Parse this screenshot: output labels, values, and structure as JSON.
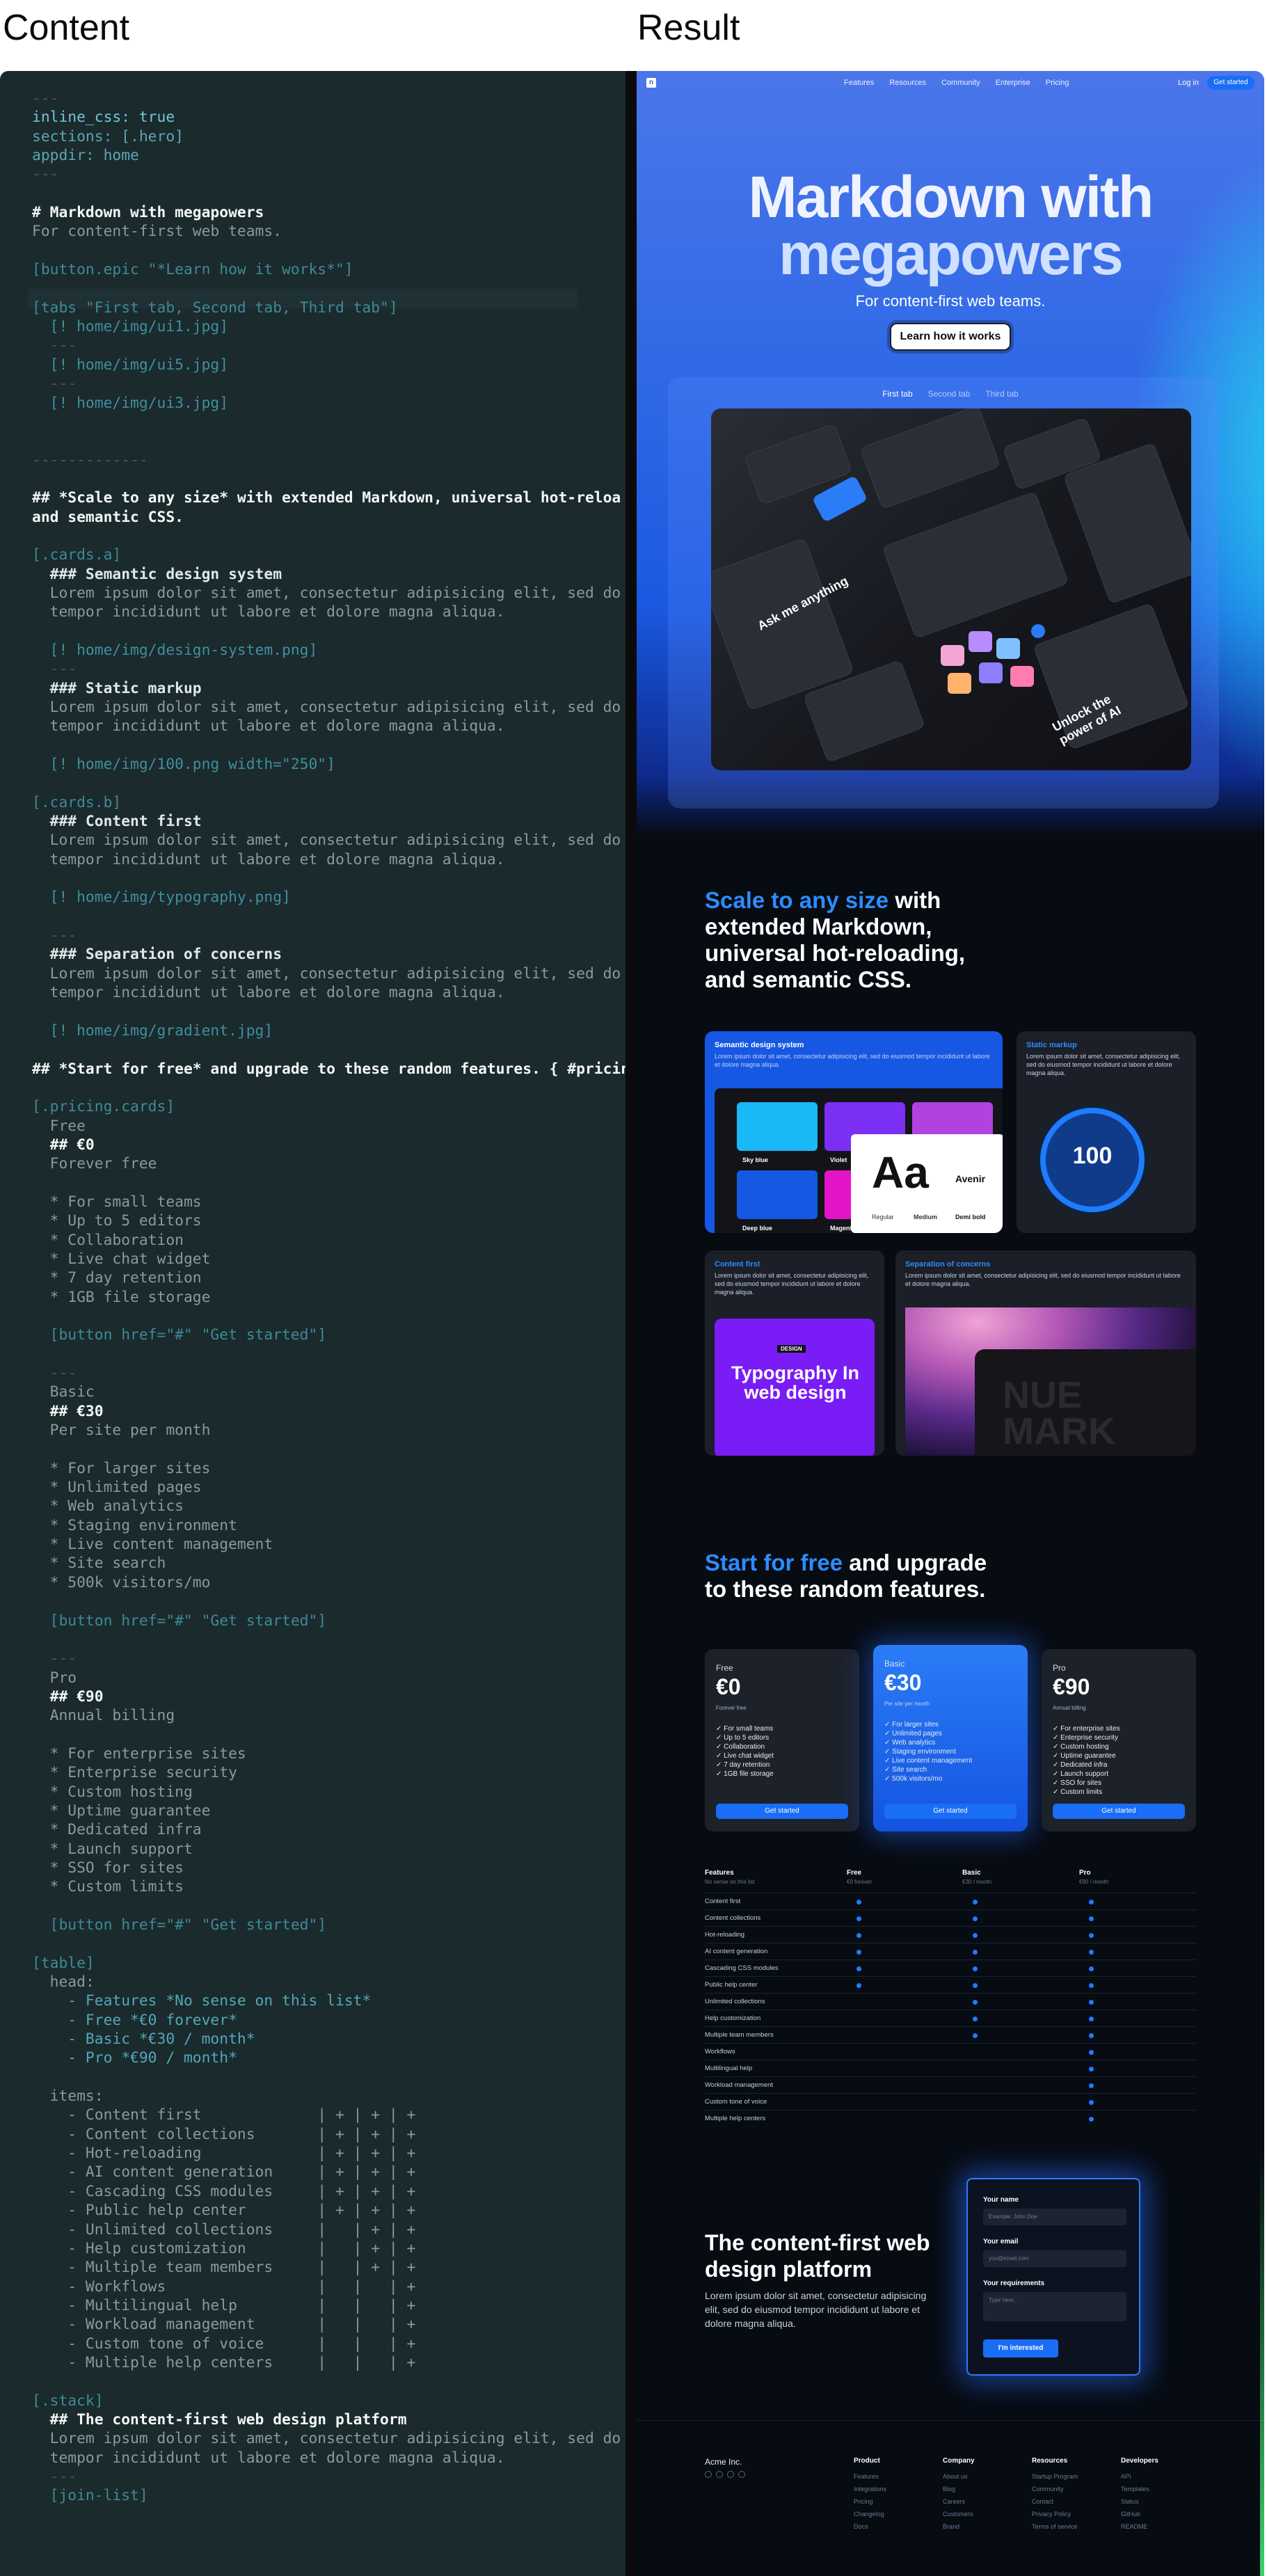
{
  "headers": {
    "left": "Content",
    "right": "Result"
  },
  "editor": {
    "lines": [
      {
        "t": "---",
        "c": "t-dim"
      },
      {
        "t": "inline_css: true",
        "c": "t-val"
      },
      {
        "t": "sections: [.hero]",
        "c": "t-key"
      },
      {
        "t": "appdir: home",
        "c": "t-key"
      },
      {
        "t": "---",
        "c": "t-dim"
      },
      {
        "t": "",
        "c": ""
      },
      {
        "t": "# Markdown with megapowers",
        "c": "t-head"
      },
      {
        "t": "For content-first web teams.",
        "c": "t-txt"
      },
      {
        "t": "",
        "c": ""
      },
      {
        "t": "[button.epic \"*Learn how it works*\"]",
        "c": "t-sec"
      },
      {
        "t": "",
        "c": ""
      },
      {
        "t": "[tabs \"First tab, Second tab, Third tab\"]",
        "c": "t-sec"
      },
      {
        "t": "  [! home/img/ui1.jpg]",
        "c": "t-link"
      },
      {
        "t": "  ---",
        "c": "t-dim"
      },
      {
        "t": "  [! home/img/ui5.jpg]",
        "c": "t-link"
      },
      {
        "t": "  ---",
        "c": "t-dim"
      },
      {
        "t": "  [! home/img/ui3.jpg]",
        "c": "t-link"
      },
      {
        "t": "",
        "c": ""
      },
      {
        "t": "",
        "c": ""
      },
      {
        "t": "-------------",
        "c": "t-dim"
      },
      {
        "t": "",
        "c": ""
      },
      {
        "t": "## *Scale to any size* with extended Markdown, universal hot-reloa",
        "c": "t-head"
      },
      {
        "t": "and semantic CSS.",
        "c": "t-head"
      },
      {
        "t": "",
        "c": ""
      },
      {
        "t": "[.cards.a]",
        "c": "t-sec"
      },
      {
        "t": "  ### Semantic design system",
        "c": "t-bright"
      },
      {
        "t": "  Lorem ipsum dolor sit amet, consectetur adipisicing elit, sed do",
        "c": "t-txt"
      },
      {
        "t": "  tempor incididunt ut labore et dolore magna aliqua.",
        "c": "t-txt"
      },
      {
        "t": "",
        "c": ""
      },
      {
        "t": "  [! home/img/design-system.png]",
        "c": "t-link"
      },
      {
        "t": "  ---",
        "c": "t-dim"
      },
      {
        "t": "  ### Static markup",
        "c": "t-bright"
      },
      {
        "t": "  Lorem ipsum dolor sit amet, consectetur adipisicing elit, sed do",
        "c": "t-txt"
      },
      {
        "t": "  tempor incididunt ut labore et dolore magna aliqua.",
        "c": "t-txt"
      },
      {
        "t": "",
        "c": ""
      },
      {
        "t": "  [! home/img/100.png width=\"250\"]",
        "c": "t-link"
      },
      {
        "t": "",
        "c": ""
      },
      {
        "t": "[.cards.b]",
        "c": "t-sec"
      },
      {
        "t": "  ### Content first",
        "c": "t-bright"
      },
      {
        "t": "  Lorem ipsum dolor sit amet, consectetur adipisicing elit, sed do",
        "c": "t-txt"
      },
      {
        "t": "  tempor incididunt ut labore et dolore magna aliqua.",
        "c": "t-txt"
      },
      {
        "t": "",
        "c": ""
      },
      {
        "t": "  [! home/img/typography.png]",
        "c": "t-link"
      },
      {
        "t": "",
        "c": ""
      },
      {
        "t": "  ---",
        "c": "t-dim"
      },
      {
        "t": "  ### Separation of concerns",
        "c": "t-bright"
      },
      {
        "t": "  Lorem ipsum dolor sit amet, consectetur adipisicing elit, sed do",
        "c": "t-txt"
      },
      {
        "t": "  tempor incididunt ut labore et dolore magna aliqua.",
        "c": "t-txt"
      },
      {
        "t": "",
        "c": ""
      },
      {
        "t": "  [! home/img/gradient.jpg]",
        "c": "t-link"
      },
      {
        "t": "",
        "c": ""
      },
      {
        "t": "## *Start for free* and upgrade to these random features. { #pricing }",
        "c": "t-head"
      },
      {
        "t": "",
        "c": ""
      },
      {
        "t": "[.pricing.cards]",
        "c": "t-sec"
      },
      {
        "t": "  Free",
        "c": "t-txt"
      },
      {
        "t": "  ## €0",
        "c": "t-head"
      },
      {
        "t": "  Forever free",
        "c": "t-txt"
      },
      {
        "t": "",
        "c": ""
      },
      {
        "t": "  * For small teams",
        "c": "t-txt"
      },
      {
        "t": "  * Up to 5 editors",
        "c": "t-txt"
      },
      {
        "t": "  * Collaboration",
        "c": "t-txt"
      },
      {
        "t": "  * Live chat widget",
        "c": "t-txt"
      },
      {
        "t": "  * 7 day retention",
        "c": "t-txt"
      },
      {
        "t": "  * 1GB file storage",
        "c": "t-txt"
      },
      {
        "t": "",
        "c": ""
      },
      {
        "t": "  [button href=\"#\" \"Get started\"]",
        "c": "t-sec"
      },
      {
        "t": "",
        "c": ""
      },
      {
        "t": "  ---",
        "c": "t-dim"
      },
      {
        "t": "  Basic",
        "c": "t-txt"
      },
      {
        "t": "  ## €30",
        "c": "t-head"
      },
      {
        "t": "  Per site per month",
        "c": "t-txt"
      },
      {
        "t": "",
        "c": ""
      },
      {
        "t": "  * For larger sites",
        "c": "t-txt"
      },
      {
        "t": "  * Unlimited pages",
        "c": "t-txt"
      },
      {
        "t": "  * Web analytics",
        "c": "t-txt"
      },
      {
        "t": "  * Staging environment",
        "c": "t-txt"
      },
      {
        "t": "  * Live content management",
        "c": "t-txt"
      },
      {
        "t": "  * Site search",
        "c": "t-txt"
      },
      {
        "t": "  * 500k visitors/mo",
        "c": "t-txt"
      },
      {
        "t": "",
        "c": ""
      },
      {
        "t": "  [button href=\"#\" \"Get started\"]",
        "c": "t-sec"
      },
      {
        "t": "",
        "c": ""
      },
      {
        "t": "  ---",
        "c": "t-dim"
      },
      {
        "t": "  Pro",
        "c": "t-txt"
      },
      {
        "t": "  ## €90",
        "c": "t-head"
      },
      {
        "t": "  Annual billing",
        "c": "t-txt"
      },
      {
        "t": "",
        "c": ""
      },
      {
        "t": "  * For enterprise sites",
        "c": "t-txt"
      },
      {
        "t": "  * Enterprise security",
        "c": "t-txt"
      },
      {
        "t": "  * Custom hosting",
        "c": "t-txt"
      },
      {
        "t": "  * Uptime guarantee",
        "c": "t-txt"
      },
      {
        "t": "  * Dedicated infra",
        "c": "t-txt"
      },
      {
        "t": "  * Launch support",
        "c": "t-txt"
      },
      {
        "t": "  * SSO for sites",
        "c": "t-txt"
      },
      {
        "t": "  * Custom limits",
        "c": "t-txt"
      },
      {
        "t": "",
        "c": ""
      },
      {
        "t": "  [button href=\"#\" \"Get started\"]",
        "c": "t-sec"
      },
      {
        "t": "",
        "c": ""
      },
      {
        "t": "[table]",
        "c": "t-sec"
      },
      {
        "t": "  head:",
        "c": "t-txt"
      },
      {
        "t": "    - Features *No sense on this list*",
        "c": "t-em"
      },
      {
        "t": "    - Free *€0 forever*",
        "c": "t-em"
      },
      {
        "t": "    - Basic *€30 / month*",
        "c": "t-em"
      },
      {
        "t": "    - Pro *€90 / month*",
        "c": "t-em"
      },
      {
        "t": "",
        "c": ""
      },
      {
        "t": "  items:",
        "c": "t-txt"
      },
      {
        "t": "    - Content first             | + | + | +",
        "c": "t-txt"
      },
      {
        "t": "    - Content collections       | + | + | +",
        "c": "t-txt"
      },
      {
        "t": "    - Hot-reloading             | + | + | +",
        "c": "t-txt"
      },
      {
        "t": "    - AI content generation     | + | + | +",
        "c": "t-txt"
      },
      {
        "t": "    - Cascading CSS modules     | + | + | +",
        "c": "t-txt"
      },
      {
        "t": "    - Public help center        | + | + | +",
        "c": "t-txt"
      },
      {
        "t": "    - Unlimited collections     |   | + | +",
        "c": "t-txt"
      },
      {
        "t": "    - Help customization        |   | + | +",
        "c": "t-txt"
      },
      {
        "t": "    - Multiple team members     |   | + | +",
        "c": "t-txt"
      },
      {
        "t": "    - Workflows                 |   |   | +",
        "c": "t-txt"
      },
      {
        "t": "    - Multilingual help         |   |   | +",
        "c": "t-txt"
      },
      {
        "t": "    - Workload management       |   |   | +",
        "c": "t-txt"
      },
      {
        "t": "    - Custom tone of voice      |   |   | +",
        "c": "t-txt"
      },
      {
        "t": "    - Multiple help centers     |   |   | +",
        "c": "t-txt"
      },
      {
        "t": "",
        "c": ""
      },
      {
        "t": "[.stack]",
        "c": "t-sec"
      },
      {
        "t": "  ## The content-first web design platform",
        "c": "t-head"
      },
      {
        "t": "  Lorem ipsum dolor sit amet, consectetur adipisicing elit, sed do eiusm",
        "c": "t-txt"
      },
      {
        "t": "  tempor incididunt ut labore et dolore magna aliqua.",
        "c": "t-txt"
      },
      {
        "t": "  ---",
        "c": "t-dim"
      },
      {
        "t": "  [join-list]",
        "c": "t-sec"
      }
    ]
  },
  "result": {
    "nav": {
      "logo": "n",
      "links": [
        "Features",
        "Resources",
        "Community",
        "Enterprise",
        "Pricing"
      ],
      "login": "Log in",
      "cta": "Get started"
    },
    "hero": {
      "title_line1": "Markdown with",
      "title_line2": "megapowers",
      "subtitle": "For content-first web teams.",
      "button": "Learn how it works",
      "tabs": [
        "First tab",
        "Second tab",
        "Third tab"
      ],
      "active_tab": 0,
      "img_text1": "Ask me anything",
      "img_text2": "Unlock the power of AI"
    },
    "features": {
      "title_em": "Scale to any size",
      "title_rest": "with extended Markdown, universal hot-reloading, and semantic CSS.",
      "cards": [
        {
          "title": "Semantic design system",
          "text": "Lorem ipsum dolor sit amet, consectetur adipisicing elit, sed do eiusmod tempor incididunt ut labore et dolore magna aliqua."
        },
        {
          "title": "Static markup",
          "text": "Lorem ipsum dolor sit amet, consectetur adipisicing elit, sed do eiusmod tempor incididunt ut labore et dolore magna aliqua."
        },
        {
          "title": "Content first",
          "text": "Lorem ipsum dolor sit amet, consectetur adipisicing elit, sed do eiusmod tempor incididunt ut labore et dolore magna aliqua."
        },
        {
          "title": "Separation of concerns",
          "text": "Lorem ipsum dolor sit amet, consectetur adipisicing elit, sed do eiusmod tempor incididunt ut labore et dolore magna aliqua."
        }
      ],
      "swatches": [
        "Sky blue",
        "Violet",
        "Deep blue",
        "Magenta"
      ],
      "type_sample": "Aa",
      "type_font": "Avenir",
      "weights": [
        "Regular",
        "Medium",
        "Demi bold"
      ],
      "badge_number": "100",
      "typo_tag": "DESIGN",
      "typo_text": "Typography In web design",
      "gradient_text": "NUE MARK"
    },
    "pricing": {
      "title_em": "Start for free",
      "title_rest": "and upgrade to these random features.",
      "plans": [
        {
          "name": "Free",
          "price": "€0",
          "per": "Forever free",
          "features": [
            "For small teams",
            "Up to 5 editors",
            "Collaboration",
            "Live chat widget",
            "7 day retention",
            "1GB file storage"
          ],
          "button": "Get started"
        },
        {
          "name": "Basic",
          "price": "€30",
          "per": "Per site per month",
          "features": [
            "For larger sites",
            "Unlimited pages",
            "Web analytics",
            "Staging environment",
            "Live content management",
            "Site search",
            "500k visitors/mo"
          ],
          "button": "Get started"
        },
        {
          "name": "Pro",
          "price": "€90",
          "per": "Annual billing",
          "features": [
            "For enterprise sites",
            "Enterprise security",
            "Custom hosting",
            "Uptime guarantee",
            "Dedicated infra",
            "Launch support",
            "SSO for sites",
            "Custom limits"
          ],
          "button": "Get started"
        }
      ]
    },
    "table": {
      "head": [
        {
          "name": "Features",
          "sub": "No sense on this list"
        },
        {
          "name": "Free",
          "sub": "€0 forever"
        },
        {
          "name": "Basic",
          "sub": "€30 / month"
        },
        {
          "name": "Pro",
          "sub": "€90 / month"
        }
      ],
      "rows": [
        {
          "name": "Content first",
          "cols": [
            1,
            1,
            1
          ]
        },
        {
          "name": "Content collections",
          "cols": [
            1,
            1,
            1
          ]
        },
        {
          "name": "Hot-reloading",
          "cols": [
            1,
            1,
            1
          ]
        },
        {
          "name": "AI content generation",
          "cols": [
            1,
            1,
            1
          ]
        },
        {
          "name": "Cascading CSS modules",
          "cols": [
            1,
            1,
            1
          ]
        },
        {
          "name": "Public help center",
          "cols": [
            1,
            1,
            1
          ]
        },
        {
          "name": "Unlimited collections",
          "cols": [
            0,
            1,
            1
          ]
        },
        {
          "name": "Help customization",
          "cols": [
            0,
            1,
            1
          ]
        },
        {
          "name": "Multiple team members",
          "cols": [
            0,
            1,
            1
          ]
        },
        {
          "name": "Workflows",
          "cols": [
            0,
            0,
            1
          ]
        },
        {
          "name": "Multilingual help",
          "cols": [
            0,
            0,
            1
          ]
        },
        {
          "name": "Workload management",
          "cols": [
            0,
            0,
            1
          ]
        },
        {
          "name": "Custom tone of voice",
          "cols": [
            0,
            0,
            1
          ]
        },
        {
          "name": "Multiple help centers",
          "cols": [
            0,
            0,
            1
          ]
        }
      ]
    },
    "stack": {
      "title": "The content-first web design platform",
      "text": "Lorem ipsum dolor sit amet, consectetur adipisicing elit, sed do eiusmod tempor incididunt ut labore et dolore magna aliqua.",
      "form": {
        "name_label": "Your name",
        "name_placeholder": "Example: John Doe",
        "email_label": "Your email",
        "email_placeholder": "you@email.com",
        "req_label": "Your requirements",
        "req_placeholder": "Type here...",
        "submit": "I'm interested"
      }
    },
    "footer": {
      "brand": "Acme Inc.",
      "columns": [
        {
          "title": "Product",
          "items": [
            "Features",
            "Integrations",
            "Pricing",
            "Changelog",
            "Docs"
          ]
        },
        {
          "title": "Company",
          "items": [
            "About us",
            "Blog",
            "Careers",
            "Customers",
            "Brand"
          ]
        },
        {
          "title": "Resources",
          "items": [
            "Startup Program",
            "Community",
            "Contact",
            "Privacy Policy",
            "Terms of service"
          ]
        },
        {
          "title": "Developers",
          "items": [
            "API",
            "Templates",
            "Status",
            "GitHub",
            "README"
          ]
        }
      ]
    }
  }
}
